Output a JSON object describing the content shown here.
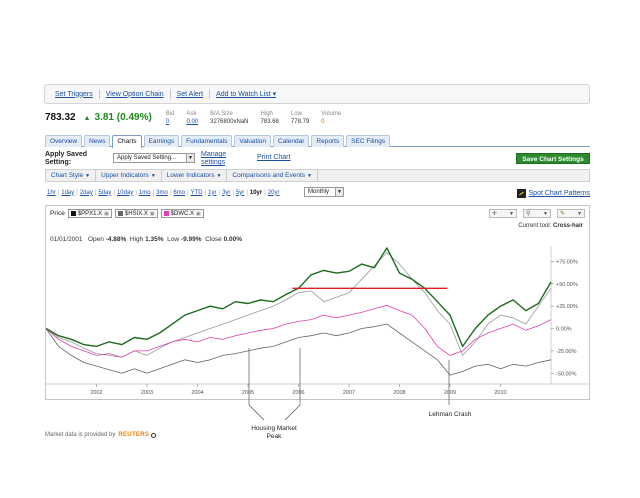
{
  "topnav": {
    "items": [
      "Set Triggers",
      "View Option Chain",
      "Set Alert",
      "Add to Watch List ▾"
    ]
  },
  "quote": {
    "price": "783.32",
    "change": "3.81 (0.49%)",
    "up_arrow": "▲",
    "stats": [
      {
        "label": "Bid",
        "value": "0"
      },
      {
        "label": "Ask",
        "value": "0.00"
      },
      {
        "label": "B/A Size",
        "value": "3276800xNaN"
      },
      {
        "label": "High",
        "value": "783.68"
      },
      {
        "label": "Low",
        "value": "778.79"
      },
      {
        "label": "Volume",
        "value": "0"
      }
    ]
  },
  "tabs": {
    "items": [
      "Overview",
      "News",
      "Charts",
      "Earnings",
      "Fundamentals",
      "Valuation",
      "Calendar",
      "Reports",
      "SEC Filings"
    ],
    "active": "Charts"
  },
  "saved": {
    "label_line1": "Apply Saved",
    "label_line2": "Setting:",
    "select_value": "Apply Saved Setting...",
    "manage_line1": "Manage",
    "manage_line2": "settings",
    "print": "Print Chart",
    "save_button": "Save Chart Settings"
  },
  "toolbar": {
    "items": [
      "Chart Style",
      "Upper Indicators",
      "Lower Indicators",
      "Comparisons and Events"
    ]
  },
  "ranges": {
    "items": [
      "1hr",
      "1day",
      "2day",
      "5day",
      "10day",
      "1mo",
      "3mo",
      "6mo",
      "YTD",
      "1yr",
      "3yr",
      "5yr",
      "10yr",
      "20yr"
    ],
    "active": "10yr",
    "interval": "Monthly",
    "spot_patterns": "Spot Chart Patterns"
  },
  "panel": {
    "price_label": "Price",
    "symbols": [
      {
        "name": "$PPX1.X",
        "color": "#111111"
      },
      {
        "name": "$HSIX.X",
        "color": "#666666"
      },
      {
        "name": "$DWC.X",
        "color": "#e040b0"
      }
    ],
    "current_tool_label": "Current tool:",
    "current_tool_value": "Cross-hair",
    "ohlc": {
      "date": "01/01/2001",
      "open_label": "Open",
      "open": "-4.88%",
      "high_label": "High",
      "high": "1.35%",
      "low_label": "Low",
      "low": "-9.99%",
      "close_label": "Close",
      "close": "0.00%"
    }
  },
  "chart_data": {
    "type": "line",
    "x": [
      2001.0,
      2001.25,
      2001.5,
      2001.75,
      2002.0,
      2002.25,
      2002.5,
      2002.75,
      2003.0,
      2003.25,
      2003.5,
      2003.75,
      2004.0,
      2004.25,
      2004.5,
      2004.75,
      2005.0,
      2005.25,
      2005.5,
      2005.75,
      2006.0,
      2006.25,
      2006.5,
      2006.75,
      2007.0,
      2007.25,
      2007.5,
      2007.75,
      2008.0,
      2008.25,
      2008.5,
      2008.75,
      2009.0,
      2009.25,
      2009.5,
      2009.75,
      2010.0,
      2010.25,
      2010.5,
      2010.75,
      2011.0
    ],
    "xticks": [
      "2002",
      "2003",
      "2004",
      "2005",
      "2006",
      "2007",
      "2008",
      "2009",
      "2010"
    ],
    "yticks": [
      "+75.00%",
      "+50.00%",
      "+25.00%",
      "0.00%",
      "-25.00%",
      "-50.00%"
    ],
    "ylim": [
      -62,
      90
    ],
    "series": [
      {
        "color": "#1b6b1b",
        "width": 1.4,
        "values": [
          0,
          -8,
          -12,
          -18,
          -20,
          -15,
          -18,
          -10,
          -12,
          -5,
          5,
          15,
          20,
          25,
          22,
          30,
          28,
          32,
          30,
          38,
          45,
          60,
          65,
          62,
          64,
          72,
          68,
          90,
          62,
          55,
          45,
          30,
          15,
          -20,
          0,
          15,
          25,
          32,
          20,
          28,
          52
        ]
      },
      {
        "color": "#999999",
        "width": 0.8,
        "values": [
          0,
          -10,
          -15,
          -22,
          -28,
          -30,
          -32,
          -25,
          -30,
          -22,
          -15,
          -10,
          -5,
          0,
          5,
          10,
          15,
          20,
          25,
          32,
          40,
          42,
          30,
          35,
          40,
          55,
          70,
          85,
          72,
          55,
          40,
          20,
          5,
          -30,
          -15,
          5,
          15,
          12,
          5,
          25,
          45
        ]
      },
      {
        "color": "#e040b0",
        "width": 0.8,
        "values": [
          0,
          -12,
          -20,
          -25,
          -30,
          -28,
          -32,
          -25,
          -25,
          -20,
          -15,
          -12,
          -15,
          -10,
          -12,
          -8,
          -5,
          -2,
          0,
          5,
          8,
          10,
          15,
          12,
          15,
          18,
          22,
          26,
          20,
          15,
          0,
          -20,
          -30,
          -25,
          -12,
          -5,
          0,
          5,
          -2,
          3,
          10
        ]
      },
      {
        "color": "#666666",
        "width": 0.8,
        "values": [
          0,
          -20,
          -30,
          -38,
          -42,
          -46,
          -50,
          -45,
          -50,
          -45,
          -40,
          -35,
          -38,
          -35,
          -30,
          -28,
          -25,
          -22,
          -20,
          -15,
          -10,
          -8,
          -5,
          -8,
          -5,
          0,
          2,
          5,
          -5,
          -15,
          -25,
          -35,
          -52,
          -48,
          -42,
          -40,
          -45,
          -40,
          -42,
          -38,
          -35
        ]
      }
    ],
    "hline": {
      "y": 45,
      "x0": 2005.88,
      "x1": 2008.95,
      "color": "#e02020"
    }
  },
  "annotations": {
    "housing": "Housing Market\nPeak",
    "lehman": "Lehman Crash"
  },
  "footer": {
    "text": "Market data is provided by",
    "brand": "REUTERS"
  }
}
